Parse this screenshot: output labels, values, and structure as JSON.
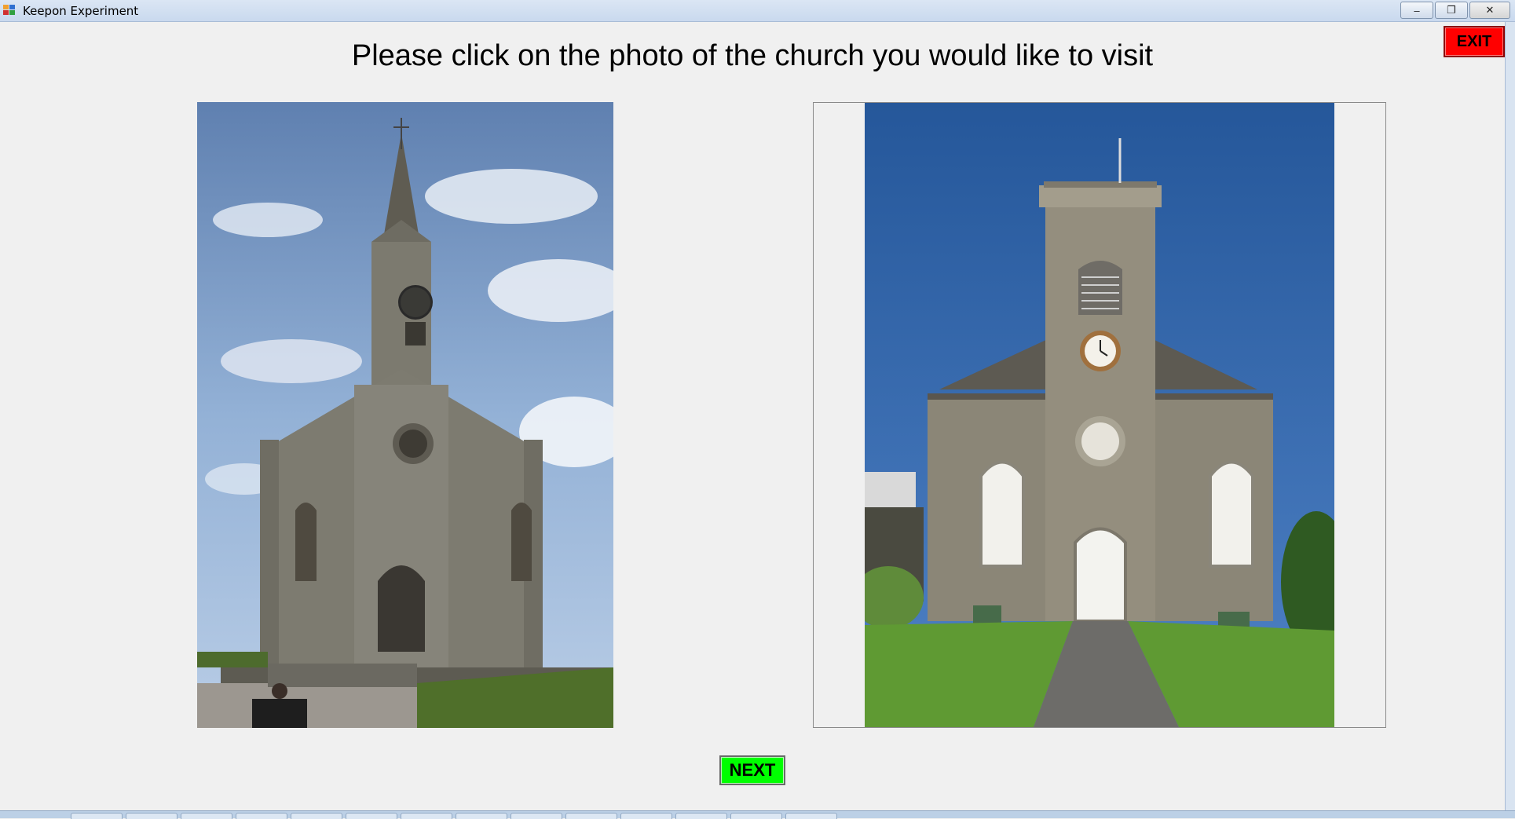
{
  "window": {
    "title": "Keepon Experiment",
    "icon": "app-window-icon",
    "controls": {
      "minimize": "–",
      "restore": "❐",
      "close": "✕"
    }
  },
  "prompt": "Please click on the photo of the church you would like to visit",
  "buttons": {
    "exit": "EXIT",
    "next": "NEXT"
  },
  "colors": {
    "exit_bg": "#ff0000",
    "next_bg": "#00ff00",
    "background": "#f0f0f0"
  },
  "photos": [
    {
      "name": "church-photo-left",
      "icon": "gothic-church-image"
    },
    {
      "name": "church-photo-right",
      "icon": "stone-tower-church-image"
    }
  ]
}
